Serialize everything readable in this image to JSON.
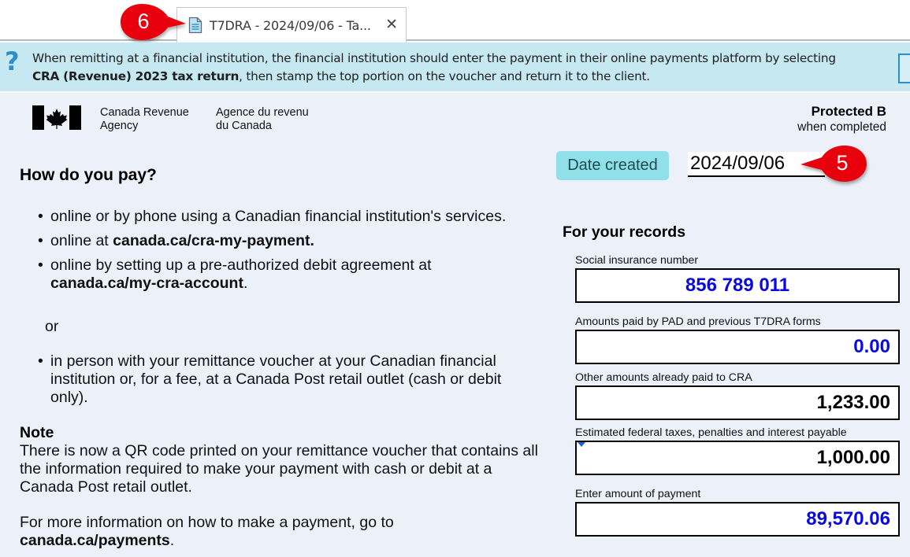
{
  "tab": {
    "title": "T7DRA - 2024/09/06 - Ta...",
    "icon": "document-icon",
    "close_icon": "close-icon",
    "close_glyph": "✕"
  },
  "callouts": [
    {
      "number": "6",
      "target": "document-tab"
    },
    {
      "number": "5",
      "target": "date-created-field"
    }
  ],
  "banner": {
    "icon": "help-question-icon",
    "icon_glyph": "?",
    "line1": "When remitting at a financial institution, the financial institution should enter the payment in their online payments platform by selecting",
    "line2_bold": "CRA (Revenue) 2023 tax return",
    "line2_rest": ",  then stamp the top portion on the voucher and return it to the client."
  },
  "header": {
    "agency_en_line1": "Canada Revenue",
    "agency_en_line2": "Agency",
    "agency_fr_line1": "Agence du revenu",
    "agency_fr_line2": "du Canada",
    "protected_title": "Protected B",
    "protected_sub": "when completed"
  },
  "date_created": {
    "label": "Date created",
    "value": "2024/09/06"
  },
  "how_to_pay": {
    "heading": "How do you pay?",
    "bullets": [
      {
        "text": "online or by phone using a Canadian financial institution's services.",
        "bold": ""
      },
      {
        "text": "online at ",
        "bold": "canada.ca/cra-my-payment."
      },
      {
        "text": "online by setting up a pre-authorized debit agreement at",
        "bold": "canada.ca/my-cra-account",
        "after": "."
      }
    ],
    "or": "or",
    "in_person": "in person with your remittance voucher at your Canadian financial institution or, for a fee, at a Canada Post retail outlet (cash or debit only)."
  },
  "note": {
    "heading": "Note",
    "text": "There is now a QR code printed on your remittance voucher that contains all the information required to make your payment with cash or debit at a Canada Post retail outlet.",
    "more_text": "For more information on how to make a payment, go to",
    "more_link": "canada.ca/payments",
    "more_after": "."
  },
  "records": {
    "heading": "For your records",
    "fields": [
      {
        "label": "Social insurance number",
        "value": "856 789 011",
        "color": "#0a0adc"
      },
      {
        "label": "Amounts paid by PAD and previous T7DRA forms",
        "value": "0.00",
        "color": "#0a0adc"
      },
      {
        "label": "Other amounts already paid to CRA",
        "value": "1,233.00",
        "color": "#000000"
      },
      {
        "label": "Estimated federal taxes, penalties and interest payable",
        "value": "1,000.00",
        "color": "#000000"
      },
      {
        "label": "Enter amount of payment",
        "value": "89,570.06",
        "color": "#0a0adc"
      }
    ]
  },
  "colors": {
    "banner_bg": "#c5e8f1",
    "form_bg": "#ebf0f9",
    "date_label_bg": "#8fe0e8",
    "callout_red": "#e8000b",
    "input_blue": "#0a0adc"
  }
}
